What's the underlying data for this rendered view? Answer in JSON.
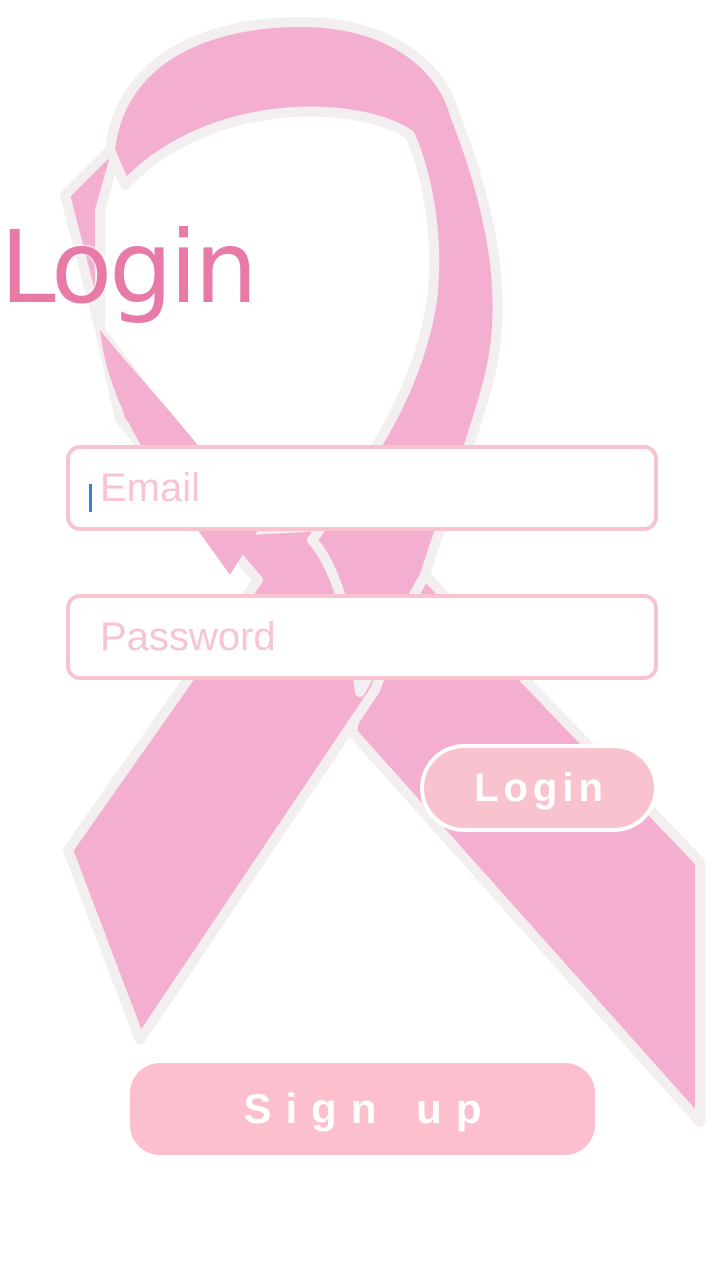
{
  "theme": {
    "ribbon_color": "#f4afd0",
    "title_color": "#e87aa8",
    "field_border": "#f9c2cf",
    "button_fill": "#f9c2cf",
    "caret_color": "#3b7ddb"
  },
  "header": {
    "title": "Login"
  },
  "form": {
    "email_placeholder": "Email",
    "password_placeholder": "Password",
    "login_label": "Login",
    "signup_label": "Sign up"
  }
}
